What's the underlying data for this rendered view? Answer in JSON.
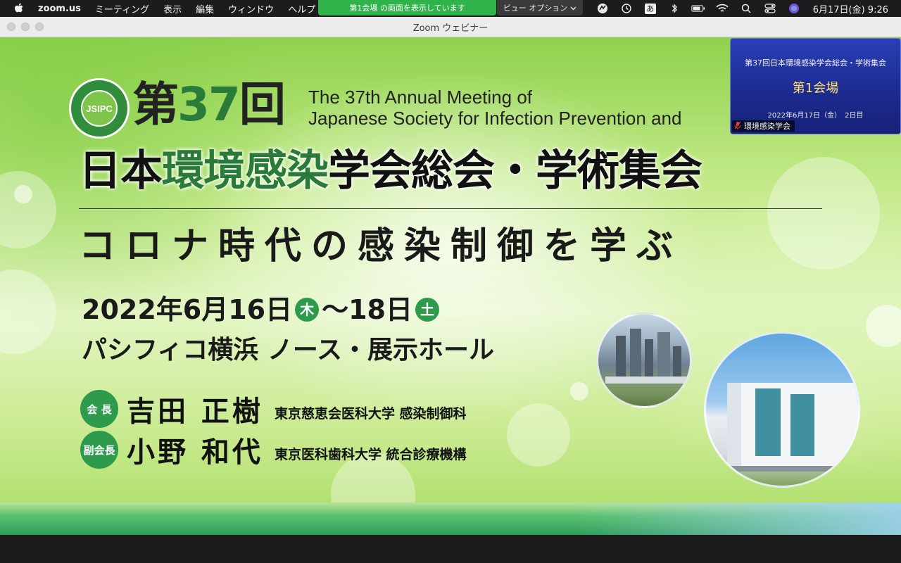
{
  "menubar": {
    "app": "zoom.us",
    "items": [
      "ミーティング",
      "表示",
      "編集",
      "ウィンドウ",
      "ヘルプ"
    ],
    "share_status": "第1会場 の画面を表示しています",
    "view_options": "ビュー オプション",
    "input_mode": "あ",
    "clock": "6月17日(金)  9:26"
  },
  "window": {
    "title": "Zoom ウェビナー"
  },
  "slide": {
    "logo_text": "JSIPC",
    "title_prefix": "第",
    "title_number": "37",
    "title_suffix": "回",
    "title_en_line1": "The 37th Annual Meeting of",
    "title_en_line2": "Japanese Society for Infection Prevention and",
    "title_main_black1": "日本",
    "title_main_green": "環境感染",
    "title_main_black2": "学会総会・学術集会",
    "subtitle": "コロナ時代の感染制御を学ぶ",
    "date_start": "2022年6月16日",
    "day_start": "木",
    "date_sep": "～18日",
    "day_end": "土",
    "venue": "パシフィコ横浜 ノース・展示ホール",
    "people": [
      {
        "role": "会 長",
        "name": "吉田 正樹",
        "affiliation": "東京慈恵会医科大学 感染制御科"
      },
      {
        "role": "副会長",
        "name": "小野 和代",
        "affiliation": "東京医科歯科大学 統合診療機構"
      }
    ]
  },
  "thumbnail": {
    "line1": "第37回日本環境感染学会総会・学術集会",
    "line2": "第1会場",
    "line3": "2022年6月17日（金）　2日目",
    "name": "環境感染学会"
  },
  "colors": {
    "accent_green": "#2e9a4b",
    "share_green": "#2fb34a",
    "thumb_blue": "#1c2a8e"
  }
}
